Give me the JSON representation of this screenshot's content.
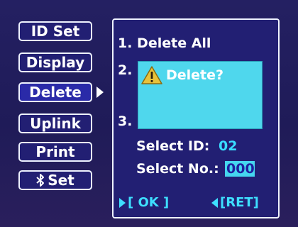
{
  "menu": {
    "items": [
      {
        "label": "ID Set"
      },
      {
        "label": "Display"
      },
      {
        "label": "Delete"
      },
      {
        "label": "Uplink"
      },
      {
        "label": "Print"
      },
      {
        "label": "Set",
        "icon": "bluetooth-icon"
      }
    ],
    "selected_index": 2
  },
  "panel": {
    "option_1": "1. Delete  All",
    "option_2_num": "2.",
    "option_3_num": "3.",
    "dialog": {
      "icon": "warning-icon",
      "text": "Delete?"
    },
    "select_id_label": "Select  ID:",
    "select_id_value": "02",
    "select_no_label": "Select  No.:",
    "select_no_value": "000",
    "ok_label": "[ OK ]",
    "ret_label": "[RET]"
  },
  "colors": {
    "background": "#221f73",
    "dialog": "#4fd7ed",
    "accent": "#3edfff",
    "text": "#ffffff"
  }
}
